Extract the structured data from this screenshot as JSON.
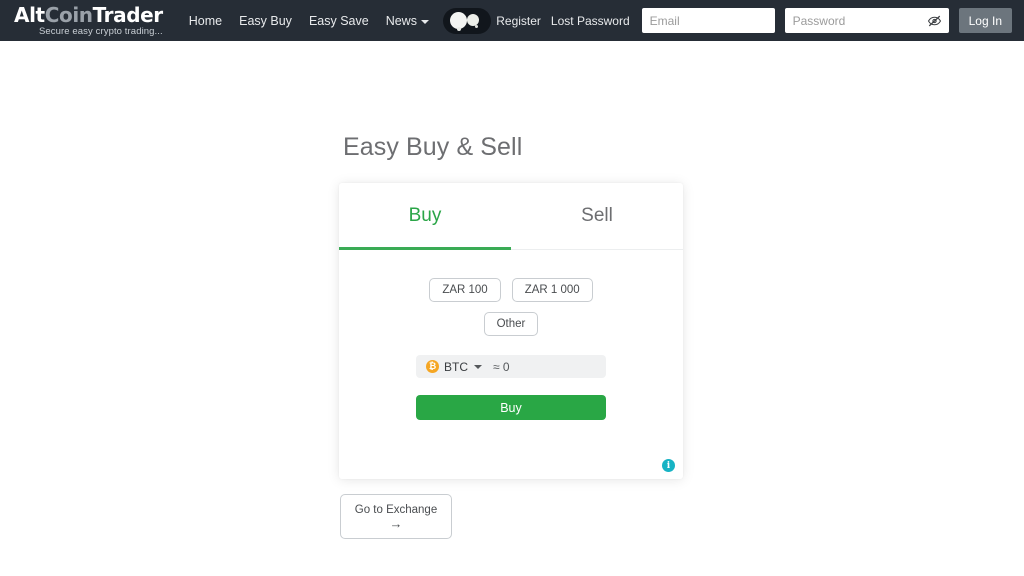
{
  "header": {
    "logo": {
      "part1": "Alt",
      "part2": "Coin",
      "part3": "Trader"
    },
    "tagline": "Secure easy crypto trading...",
    "mascot_icon": "mascot-icon",
    "nav": [
      {
        "label": "Home",
        "has_caret": false
      },
      {
        "label": "Easy Buy",
        "has_caret": false
      },
      {
        "label": "Easy Save",
        "has_caret": false
      },
      {
        "label": "News",
        "has_caret": true
      }
    ],
    "auth": {
      "register_label": "Register",
      "lost_password_label": "Lost Password",
      "email_placeholder": "Email",
      "email_value": "",
      "password_placeholder": "Password",
      "password_value": "",
      "toggle_password_icon": "eye-slash-icon",
      "login_label": "Log In"
    },
    "background_color": "#262d36"
  },
  "main": {
    "page_title": "Easy Buy & Sell",
    "card": {
      "tabs": [
        {
          "label": "Buy",
          "active": true
        },
        {
          "label": "Sell",
          "active": false
        }
      ],
      "active_tab_color": "#2aa547",
      "amount_options": [
        {
          "label": "ZAR 100"
        },
        {
          "label": "ZAR 1 000"
        },
        {
          "label": "Other"
        }
      ],
      "coin_selector": {
        "icon": "bitcoin-icon",
        "icon_glyph": "₿",
        "icon_color": "#f5a623",
        "symbol": "BTC",
        "caret_icon": "chevron-down-icon",
        "approx_value": "≈ 0"
      },
      "submit_label": "Buy",
      "submit_color": "#29a745",
      "info_icon": "info-icon",
      "info_glyph": "i",
      "info_color": "#17b3c4"
    },
    "exchange_button": {
      "label": "Go to Exchange",
      "arrow_glyph": "→",
      "arrow_icon": "arrow-right-icon"
    }
  }
}
